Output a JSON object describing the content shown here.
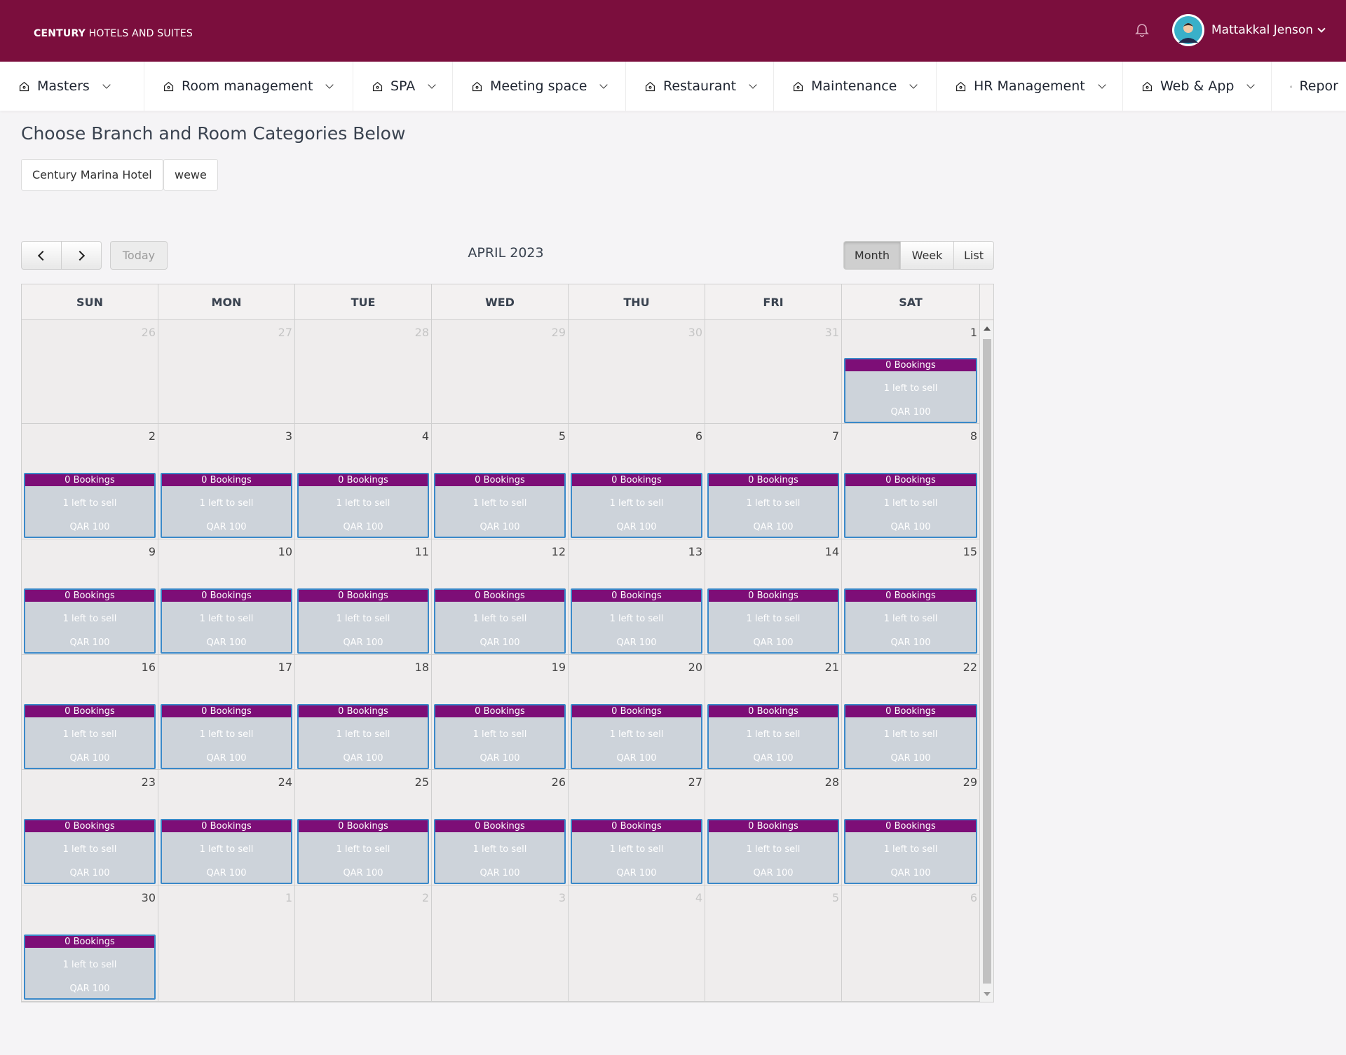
{
  "header": {
    "brand_bold": "CENTURY",
    "brand_rest": " HOTELS AND SUITES",
    "user_name": "Mattakkal Jenson"
  },
  "nav": [
    {
      "label": "Masters"
    },
    {
      "label": "Room management"
    },
    {
      "label": "SPA"
    },
    {
      "label": "Meeting space"
    },
    {
      "label": "Restaurant"
    },
    {
      "label": "Maintenance"
    },
    {
      "label": "HR Management"
    },
    {
      "label": "Web & App"
    },
    {
      "label": "Repor"
    }
  ],
  "page": {
    "title": "Choose Branch and Room Categories Below",
    "branch": "Century Marina Hotel",
    "category": "wewe"
  },
  "toolbar": {
    "today": "Today",
    "title": "APRIL 2023",
    "views": [
      "Month",
      "Week",
      "List"
    ],
    "active_view": "Month"
  },
  "calendar": {
    "days_of_week": [
      "SUN",
      "MON",
      "TUE",
      "WED",
      "THU",
      "FRI",
      "SAT"
    ],
    "weeks": [
      [
        {
          "day": "26",
          "other": true
        },
        {
          "day": "27",
          "other": true
        },
        {
          "day": "28",
          "other": true
        },
        {
          "day": "29",
          "other": true
        },
        {
          "day": "30",
          "other": true
        },
        {
          "day": "31",
          "other": true
        },
        {
          "day": "1",
          "event": true
        }
      ],
      [
        {
          "day": "2",
          "event": true
        },
        {
          "day": "3",
          "event": true
        },
        {
          "day": "4",
          "event": true
        },
        {
          "day": "5",
          "event": true
        },
        {
          "day": "6",
          "event": true
        },
        {
          "day": "7",
          "event": true
        },
        {
          "day": "8",
          "event": true
        }
      ],
      [
        {
          "day": "9",
          "event": true
        },
        {
          "day": "10",
          "event": true
        },
        {
          "day": "11",
          "event": true
        },
        {
          "day": "12",
          "event": true
        },
        {
          "day": "13",
          "event": true
        },
        {
          "day": "14",
          "event": true
        },
        {
          "day": "15",
          "event": true
        }
      ],
      [
        {
          "day": "16",
          "event": true
        },
        {
          "day": "17",
          "event": true
        },
        {
          "day": "18",
          "event": true
        },
        {
          "day": "19",
          "event": true
        },
        {
          "day": "20",
          "event": true
        },
        {
          "day": "21",
          "event": true
        },
        {
          "day": "22",
          "event": true
        }
      ],
      [
        {
          "day": "23",
          "event": true
        },
        {
          "day": "24",
          "event": true
        },
        {
          "day": "25",
          "event": true
        },
        {
          "day": "26",
          "event": true
        },
        {
          "day": "27",
          "event": true
        },
        {
          "day": "28",
          "event": true
        },
        {
          "day": "29",
          "event": true
        }
      ],
      [
        {
          "day": "30",
          "event": true
        },
        {
          "day": "1",
          "other": true
        },
        {
          "day": "2",
          "other": true
        },
        {
          "day": "3",
          "other": true
        },
        {
          "day": "4",
          "other": true
        },
        {
          "day": "5",
          "other": true
        },
        {
          "day": "6",
          "other": true
        }
      ]
    ],
    "event": {
      "bookings": "0 Bookings",
      "availability": "1 left to sell",
      "price": "QAR 100"
    }
  },
  "colors": {
    "brand": "#7b0e3d",
    "event_header": "#7d0e77",
    "event_body": "#cdd3da",
    "event_border": "#3a89c9"
  }
}
